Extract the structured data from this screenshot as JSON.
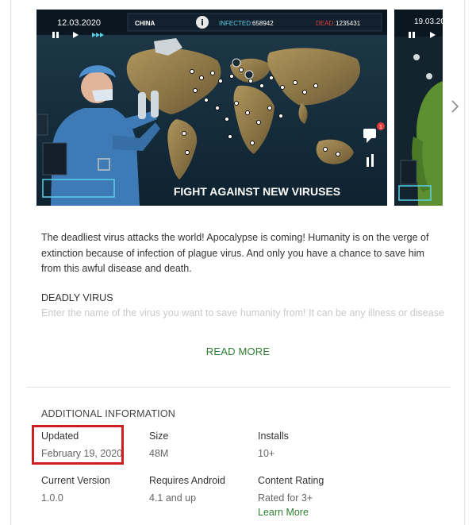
{
  "screenshots": {
    "main": {
      "date": "12.03.2020",
      "region": "CHINA",
      "infected_label": "INFECTED:",
      "infected_value": "658942",
      "dead_label": "DEAD:",
      "dead_value": "1235431",
      "caption": "FIGHT AGAINST NEW VIRUSES",
      "notification_count": "1"
    },
    "second": {
      "date": "19.03.20"
    }
  },
  "description": {
    "paragraph": "The deadliest virus attacks the world! Apocalypse is coming! Humanity is on the verge of extinction because of infection of plague virus. And only you have a chance to save him from this awful disease and death.",
    "heading": "DEADLY VIRUS",
    "faded": "Enter the name of the virus you want to save humanity from! It can be any illness or disease"
  },
  "read_more": "READ MORE",
  "additional": {
    "title": "ADDITIONAL INFORMATION",
    "updated_label": "Updated",
    "updated_value": "February 19, 2020",
    "size_label": "Size",
    "size_value": "48M",
    "installs_label": "Installs",
    "installs_value": "10+",
    "version_label": "Current Version",
    "version_value": "1.0.0",
    "android_label": "Requires Android",
    "android_value": "4.1 and up",
    "rating_label": "Content Rating",
    "rating_value": "Rated for 3+",
    "learn_more": "Learn More"
  },
  "colors": {
    "accent_green": "#2e7d32",
    "highlight_red": "#cc1f1f",
    "infected_cyan": "#5ad0e6",
    "dead_red": "#e03a3a"
  }
}
